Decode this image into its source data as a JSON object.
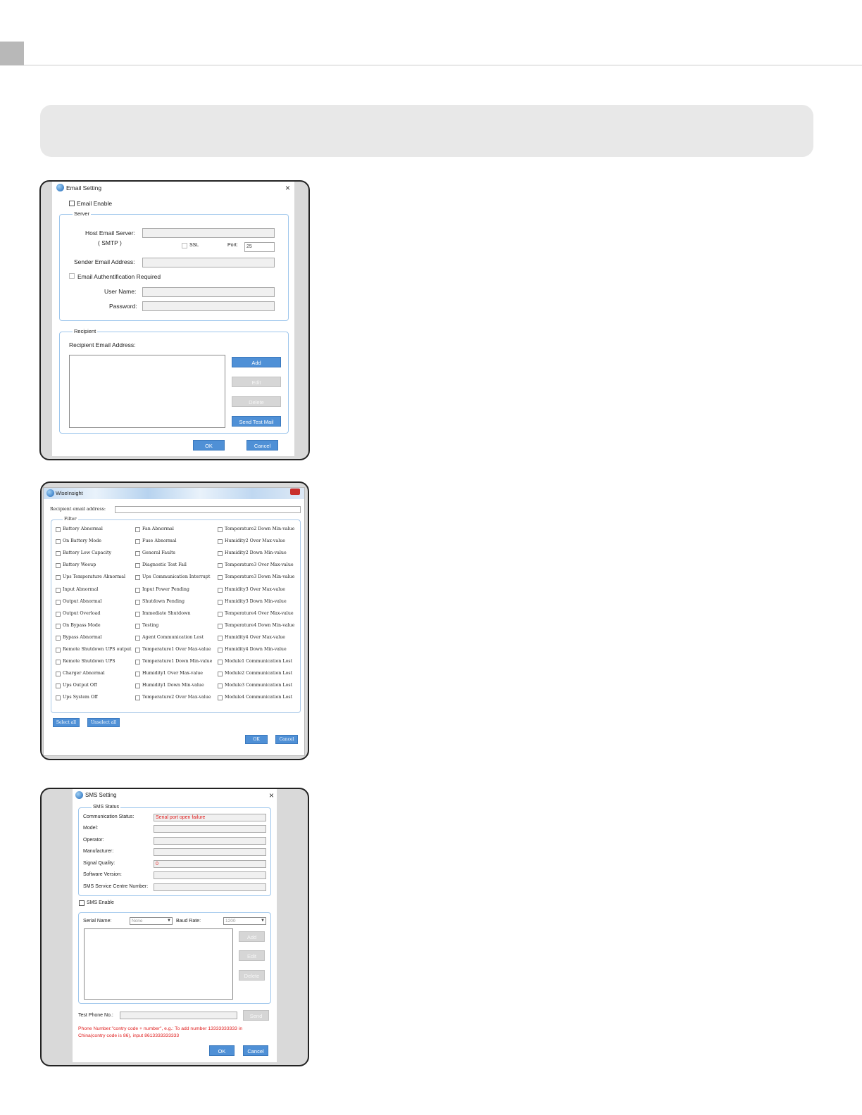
{
  "email_dialog": {
    "title": "Email Setting",
    "close": "×",
    "email_enable": "Email Enable",
    "server_legend": "Server",
    "host_label": "Host Email Server:",
    "smtp_label": "( SMTP )",
    "ssl_label": "SSL",
    "port_label": "Port:",
    "port_value": "25",
    "sender_label": "Sender Email Address:",
    "auth_label": "Email Authentification Required",
    "user_label": "User Name:",
    "password_label": "Password:",
    "recipient_legend": "Recipient",
    "recipient_label": "Recipient Email Address:",
    "add": "Add",
    "edit": "Edit",
    "delete": "Delete",
    "send_test": "Send Test Mail",
    "ok": "OK",
    "cancel": "Cancel"
  },
  "wise_dialog": {
    "title": "WiseInsight",
    "recipient_label": "Recipient email address:",
    "filter_legend": "Filter",
    "columns": [
      [
        "Battery Abnormal",
        "On Battery Mode",
        "Battery Low Capacity",
        "Battery Weeup",
        "Ups Temperature Abnormal",
        "Input Abnormal",
        "Output Abnormal",
        "Output Overload",
        "On Bypass Mode",
        "Bypass Abnormal",
        "Remote Shutdown UPS output",
        "Remote Shutdown UPS",
        "Charger Abnormal",
        "Ups Output Off",
        "Ups System Off"
      ],
      [
        "Fan Abnormal",
        "Fuse Abnormal",
        "General Faults",
        "Diagnostic Test Fail",
        "Ups Communication Interrupt",
        "Input Power Pending",
        "Shutdown Pending",
        "Immediate Shutdown",
        "Testing",
        "Agent Communication Lost",
        "Temperature1 Over Max-value",
        "Temperature1 Down Min-value",
        "Humidity1  Over Max-value",
        "Humidity1  Down Min-value",
        "Temperature2 Over Max-value"
      ],
      [
        "Temperature2 Down Min-value",
        "Humidity2  Over Max-value",
        "Humidity2  Down Min-value",
        "Temperature3 Over Max-value",
        "Temperature3 Down Min-value",
        "Humidity3  Over Max-value",
        "Humidity3  Down Min-value",
        "Temperature4 Over Max-value",
        "Temperature4 Down Min-value",
        "Humidity4  Over Max-value",
        "Humidity4  Down Min-value",
        "Module1 Communication Lost",
        "Module2 Communication Lost",
        "Module3 Communication Lost",
        "Module4 Communication Lost"
      ]
    ],
    "select_all": "Select all",
    "unselect_all": "Unselect all",
    "ok": "OK",
    "cancel": "Cancel"
  },
  "sms_dialog": {
    "title": "SMS Setting",
    "close": "×",
    "status_legend": "SMS Status",
    "comm_label": "Communication Status:",
    "comm_value": "Serial port open failure",
    "model_label": "Model:",
    "operator_label": "Operator:",
    "manufacturer_label": "Manufacturer:",
    "signal_label": "Signal Quality:",
    "signal_value": "0",
    "software_label": "Software Version:",
    "centre_label": "SMS Service Centre Number:",
    "sms_enable": "SMS Enable",
    "serial_label": "Serial Name:",
    "serial_value": "None",
    "baud_label": "Baud Rate:",
    "baud_value": "1200",
    "add": "Add",
    "edit": "Edit",
    "delete": "Delete",
    "test_phone_label": "Test Phone No.:",
    "send": "Send",
    "note_line1": "Phone Number:\"contry code + number\", e.g.: To add number 13333333333 in",
    "note_line2": "China(contry code is 86), input 8613333333333",
    "ok": "OK",
    "cancel": "Cancel"
  }
}
